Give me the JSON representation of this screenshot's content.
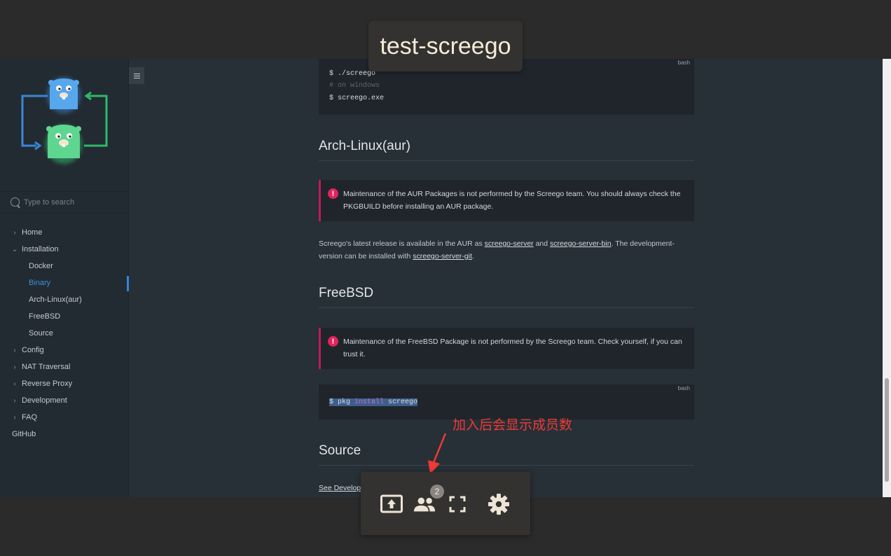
{
  "room": {
    "title": "test-screego"
  },
  "search": {
    "placeholder": "Type to search"
  },
  "nav": {
    "home": "Home",
    "installation": "Installation",
    "docker": "Docker",
    "binary": "Binary",
    "arch": "Arch-Linux(aur)",
    "freebsd": "FreeBSD",
    "source": "Source",
    "config": "Config",
    "nat": "NAT Traversal",
    "proxy": "Reverse Proxy",
    "development": "Development",
    "faq": "FAQ",
    "github": "GitHub"
  },
  "code1": {
    "lang": "bash",
    "line1": "$ ./screego",
    "line2": "# on windows",
    "line3": "$ screego.exe"
  },
  "arch": {
    "heading": "Arch-Linux(aur)",
    "alert": "Maintenance of the AUR Packages is not performed by the Screego team. You should always check the PKGBUILD before installing an AUR package.",
    "p_a": "Screego's latest release is available in the AUR as ",
    "link1": "screego-server",
    "p_b": " and ",
    "link2": "screego-server-bin",
    "p_c": ". The development-version can be installed with ",
    "link3": "screego-server-git",
    "p_d": "."
  },
  "freebsd": {
    "heading": "FreeBSD",
    "alert": "Maintenance of the FreeBSD Package is not performed by the Screego team. Check yourself, if you can trust it."
  },
  "code2": {
    "lang": "bash",
    "prefix": "$ pkg ",
    "kw": "install",
    "suffix": " screego"
  },
  "source": {
    "heading": "Source",
    "link": "See Develop"
  },
  "annotation": "加入后会显示成员数",
  "toolbar": {
    "members_count": "2"
  },
  "colors": {
    "accent": "#2e86de",
    "alert": "#e0245e",
    "annotation": "#ee3a34"
  }
}
